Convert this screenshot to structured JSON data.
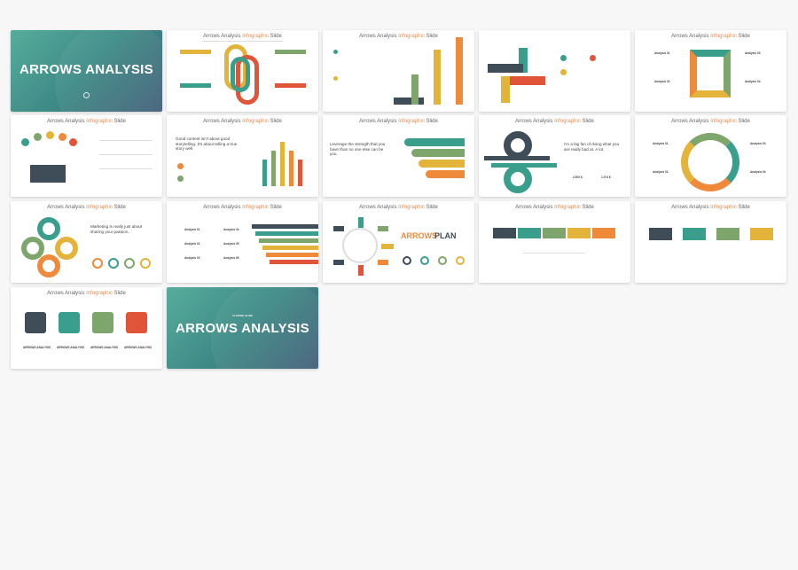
{
  "colors": {
    "teal": "#3a9e8c",
    "green": "#7ea66c",
    "yellow": "#e4b43a",
    "orange": "#ee8a3a",
    "red": "#e0553a",
    "dark": "#3f4d58",
    "cover_gradient": "#56ad9c"
  },
  "slide_title": {
    "pre": "Arrows Analysis ",
    "hl": "Infographic",
    "post": " Slide"
  },
  "slides": {
    "s1": {
      "title": "ARROWS ANALYSIS"
    },
    "s7": {
      "headline": "Good content isn't about good storytelling. It's about telling a true story well."
    },
    "s8": {
      "headline": "Leverage the strength that you have than no one else can be you."
    },
    "s9": {
      "headline": "I'm a big fan of doing what you are really bad at. A lot.",
      "stat1": "2.000 $",
      "stat2": "1.074 $"
    },
    "s10": {
      "labels": [
        "Analysis 01",
        "Analysis 02",
        "Analysis 03",
        "Analysis 04"
      ]
    },
    "s11": {
      "headline": "Marketing is really just about sharing your passion."
    },
    "s12": {
      "labels": [
        "Analysis 01",
        "Analysis 02",
        "Analysis 03",
        "Analysis 04",
        "Analysis 05",
        "Analysis 06"
      ]
    },
    "s13": {
      "title_a": "ARROWS",
      "title_b": "PLAN"
    },
    "s16": {
      "labels": [
        "ARROWS ANALYSIS",
        "ARROWS ANALYSIS",
        "ARROWS ANALYSIS",
        "ARROWS ANALYSIS"
      ]
    },
    "s17": {
      "kicker": "CLOSING SLIDE",
      "title": "ARROWS ANALYSIS"
    },
    "s5": {
      "labels": [
        "Analysis 01",
        "Analysis 02",
        "Analysis 03",
        "Analysis 04"
      ]
    }
  }
}
